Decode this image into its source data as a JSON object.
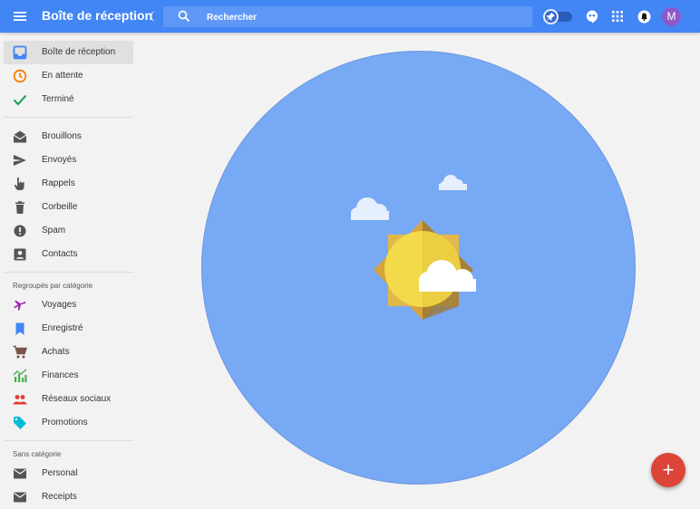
{
  "header": {
    "title": "Boîte de réception",
    "search_placeholder": "Rechercher",
    "avatar_initial": "M",
    "colors": {
      "bar": "#4285f4",
      "search": "#5f97f6",
      "avatar": "#8d59c9"
    }
  },
  "sidebar": {
    "primary": [
      {
        "label": "Boîte de réception",
        "icon": "inbox-icon",
        "active": true
      },
      {
        "label": "En attente",
        "icon": "clock-icon"
      },
      {
        "label": "Terminé",
        "icon": "check-icon"
      }
    ],
    "secondary": [
      {
        "label": "Brouillons",
        "icon": "drafts-icon"
      },
      {
        "label": "Envoyés",
        "icon": "send-icon"
      },
      {
        "label": "Rappels",
        "icon": "reminder-hand-icon"
      },
      {
        "label": "Corbeille",
        "icon": "trash-icon"
      },
      {
        "label": "Spam",
        "icon": "spam-icon"
      },
      {
        "label": "Contacts",
        "icon": "contacts-icon"
      }
    ],
    "bundles_header": "Regroupés par catégorie",
    "bundles": [
      {
        "label": "Voyages",
        "icon": "plane-icon",
        "color": "#9c27b0"
      },
      {
        "label": "Enregistré",
        "icon": "bookmark-icon",
        "color": "#4285f4"
      },
      {
        "label": "Achats",
        "icon": "cart-icon",
        "color": "#795548"
      },
      {
        "label": "Finances",
        "icon": "finance-icon",
        "color": "#4caf50"
      },
      {
        "label": "Réseaux sociaux",
        "icon": "people-icon",
        "color": "#e53935"
      },
      {
        "label": "Promotions",
        "icon": "tag-icon",
        "color": "#00bcd4"
      }
    ],
    "uncategorized_header": "Sans catégorie",
    "uncategorized": [
      {
        "label": "Personal",
        "icon": "mail-icon"
      },
      {
        "label": "Receipts",
        "icon": "mail-icon"
      }
    ]
  },
  "main": {
    "illustration": "sun-and-clouds-icon",
    "circle_color": "#78a9f5",
    "fab_label": "+",
    "fab_color": "#db4437"
  }
}
